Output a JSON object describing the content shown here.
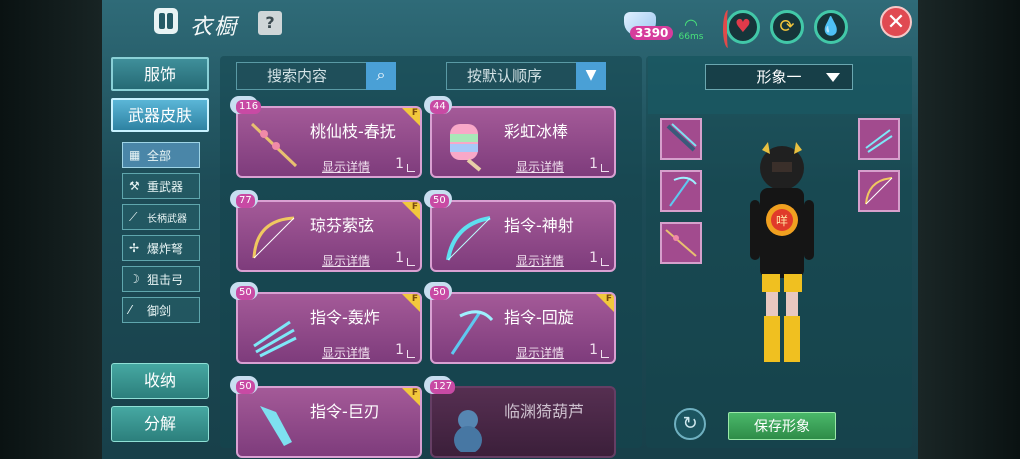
{
  "header": {
    "title": "衣橱",
    "help": "?",
    "currency": "3390",
    "ping": "66ms",
    "close": "✕"
  },
  "nav": {
    "tabs": [
      {
        "label": "服饰",
        "active": false
      },
      {
        "label": "武器皮肤",
        "active": true
      }
    ],
    "categories": [
      {
        "label": "全部",
        "icon": "grid-icon",
        "active": true
      },
      {
        "label": "重武器",
        "icon": "hammer-icon",
        "active": false
      },
      {
        "label": "长柄武器",
        "icon": "polearm-icon",
        "active": false
      },
      {
        "label": "爆炸弩",
        "icon": "crossbow-icon",
        "active": false
      },
      {
        "label": "狙击弓",
        "icon": "bow-icon",
        "active": false
      },
      {
        "label": "御剑",
        "icon": "sword-icon",
        "active": false
      }
    ],
    "store": "收纳",
    "decompose": "分解"
  },
  "toolbar": {
    "search_placeholder": "搜索内容",
    "sort_label": "按默认顺序"
  },
  "cards": [
    {
      "name": "桃仙枝-春抚",
      "level": "116",
      "detail": "显示详情",
      "qty": "1",
      "tag": "F"
    },
    {
      "name": "彩虹冰棒",
      "level": "44",
      "detail": "显示详情",
      "qty": "1",
      "tag": ""
    },
    {
      "name": "琼芬萦弦",
      "level": "77",
      "detail": "显示详情",
      "qty": "1",
      "tag": "F"
    },
    {
      "name": "指令-神射",
      "level": "50",
      "detail": "显示详情",
      "qty": "1",
      "tag": ""
    },
    {
      "name": "指令-轰炸",
      "level": "50",
      "detail": "显示详情",
      "qty": "1",
      "tag": "F"
    },
    {
      "name": "指令-回旋",
      "level": "50",
      "detail": "显示详情",
      "qty": "1",
      "tag": "F"
    },
    {
      "name": "指令-巨刃",
      "level": "50",
      "detail": "",
      "qty": "",
      "tag": "F"
    },
    {
      "name": "临渊猗葫芦",
      "level": "127",
      "detail": "",
      "qty": "",
      "tag": ""
    }
  ],
  "preview": {
    "form_label": "形象一",
    "save_label": "保存形象",
    "badge": "咩"
  },
  "colors": {
    "card": "#a45a98",
    "accent": "#4aa0d6",
    "save": "#3aa55a"
  }
}
